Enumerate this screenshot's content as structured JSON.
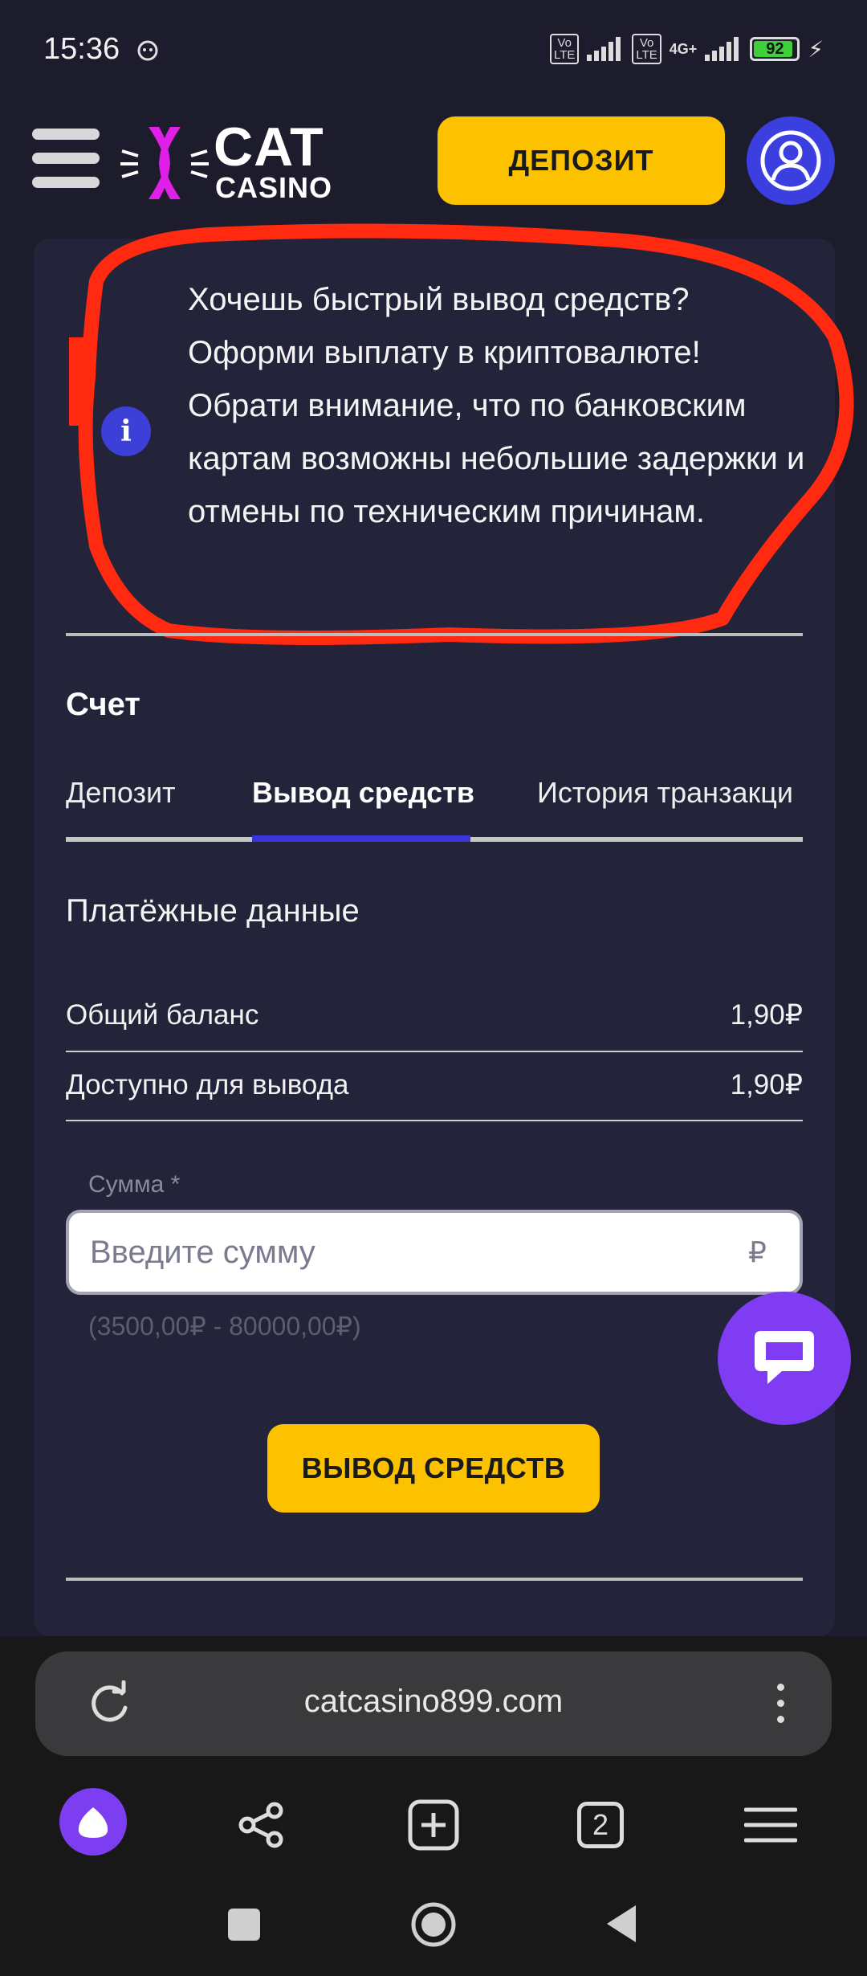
{
  "status_bar": {
    "time": "15:36",
    "volte1": "Vo LTE",
    "volte2": "Vo LTE",
    "network": "4G+",
    "battery": "92",
    "battery_level_percent": 92
  },
  "header": {
    "logo_title": "CAT",
    "logo_subtitle": "CASINO",
    "deposit_label": "ДЕПОЗИТ",
    "accent_color": "#fcc200",
    "avatar_color": "#3b3fe0"
  },
  "notice": {
    "icon": "info-icon",
    "icon_glyph": "i",
    "text": "Хочешь быстрый вывод средств? Оформи выплату в криптовалюте! Обрати внимание, что по банковским картам возможны небольшие задержки и отмены по техническим причинам.",
    "annotation_color": "#ff2a10"
  },
  "account": {
    "title": "Счет",
    "tabs": [
      {
        "label": "Депозит",
        "active": false
      },
      {
        "label": "Вывод средств",
        "active": true
      },
      {
        "label": "История транзакци",
        "active": false
      }
    ],
    "payment_title": "Платёжные данные",
    "rows": [
      {
        "label": "Общий баланс",
        "value": "1,90₽"
      },
      {
        "label": "Доступно для вывода",
        "value": "1,90₽"
      }
    ],
    "amount_label": "Сумма *",
    "amount_placeholder": "Введите сумму",
    "amount_value": "",
    "currency_sign": "₽",
    "range_hint": "(3500,00₽ - 80000,00₽)",
    "withdraw_label": "ВЫВОД СРЕДСТВ"
  },
  "chat_button": {
    "icon": "chat-bubble-icon",
    "color": "#7f3cf2"
  },
  "browser": {
    "url": "catcasino899.com",
    "tabs_count": "2"
  }
}
